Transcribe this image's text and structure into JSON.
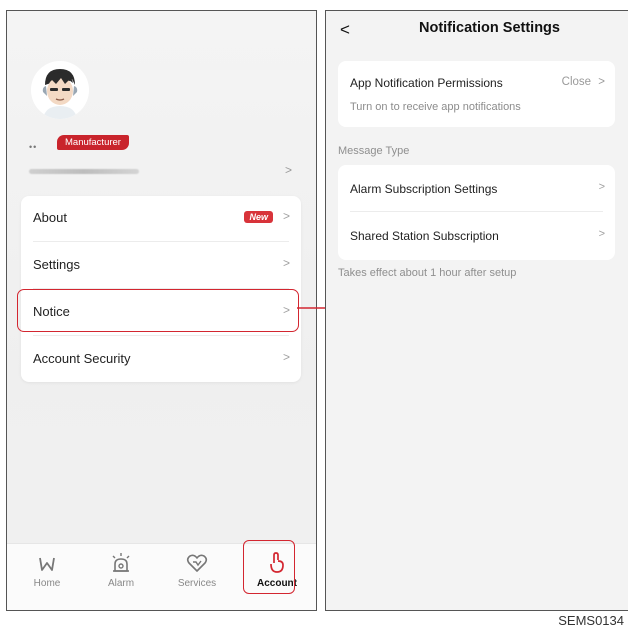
{
  "account_screen": {
    "badge": "Manufacturer",
    "name_masked": "••",
    "menu": [
      {
        "label": "About",
        "badge": "New"
      },
      {
        "label": "Settings"
      },
      {
        "label": "Notice"
      },
      {
        "label": "Account Security"
      }
    ],
    "tabs": [
      {
        "label": "Home",
        "icon": "home-icon"
      },
      {
        "label": "Alarm",
        "icon": "alarm-icon"
      },
      {
        "label": "Services",
        "icon": "services-icon"
      },
      {
        "label": "Account",
        "icon": "account-icon",
        "active": true
      }
    ],
    "accent_color": "#d32630"
  },
  "notification_screen": {
    "back": "<",
    "title": "Notification Settings",
    "permission": {
      "title": "App Notification Permissions",
      "status": "Close",
      "subtitle": "Turn on to receive app notifications"
    },
    "section_label": "Message Type",
    "items": [
      {
        "label": "Alarm Subscription Settings"
      },
      {
        "label": "Shared Station Subscription"
      }
    ],
    "note": "Takes effect about 1 hour after setup"
  },
  "chevron": ">",
  "caption": "SEMS0134"
}
